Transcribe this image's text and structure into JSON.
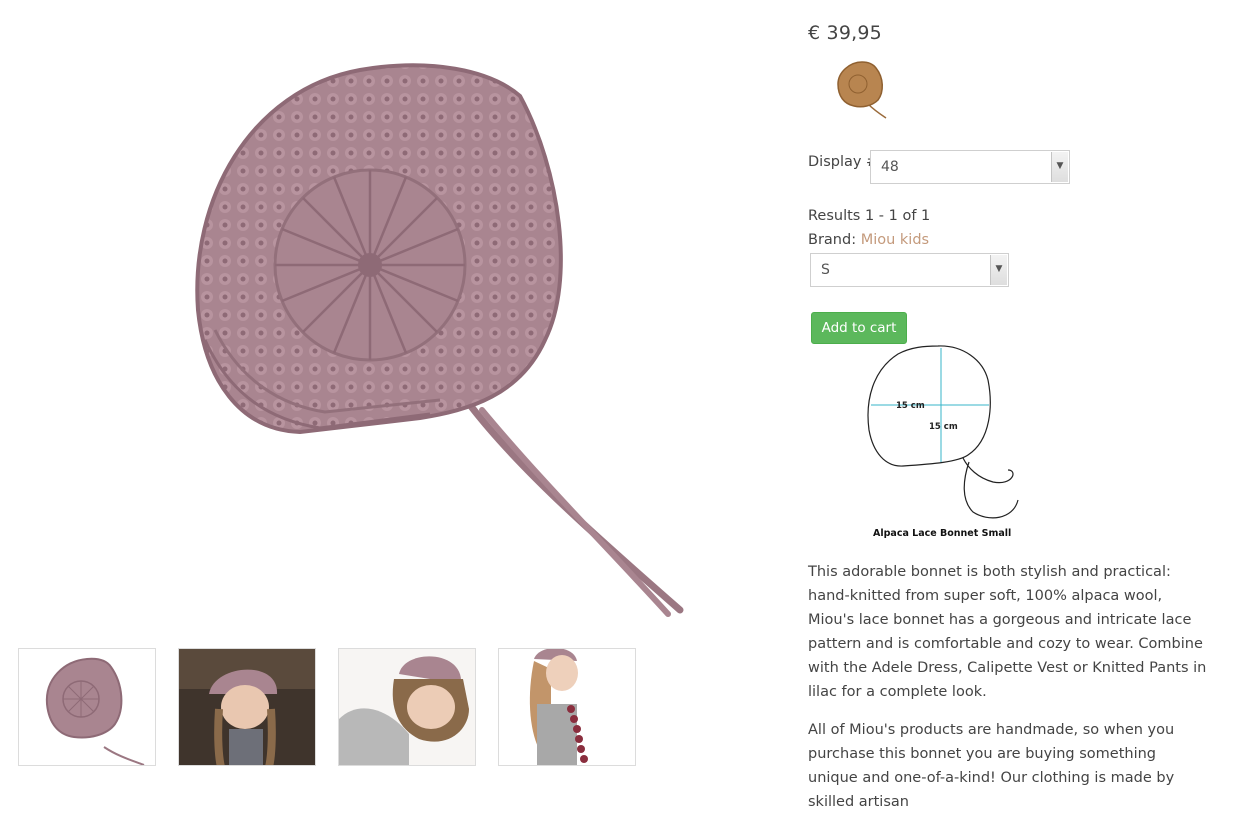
{
  "product": {
    "price": "€ 39,95",
    "display": {
      "label": "Display #",
      "value": "48"
    },
    "results": "Results 1 - 1 of 1",
    "brand": {
      "label": "Brand:",
      "name": "Miou kids"
    },
    "size_select": {
      "value": "S"
    },
    "add_to_cart_label": "Add to cart",
    "diagram": {
      "width_label": "15 cm",
      "height_label": "15 cm",
      "caption": "Alpaca Lace Bonnet Small"
    },
    "description": [
      "This adorable bonnet is both stylish and practical: hand-knitted from super soft, 100% alpaca wool, Miou's lace bonnet has a gorgeous and intricate lace pattern and is comfortable and cozy to wear. Combine with the Adele Dress, Calipette Vest or Knitted Pants in lilac for a complete look.",
      "All of Miou's products are handmade, so when you purchase this bonnet you are buying something unique and one-of-a-kind! Our clothing is made by skilled artisan"
    ]
  },
  "colors": {
    "bonnet": "#a98590",
    "bonnet_dark": "#8e6a76",
    "swatch": "#b88550",
    "brand_link": "#c49a7c",
    "button": "#5cb85c",
    "measure_line": "#37b6c8"
  },
  "thumbnails": [
    {
      "icon": "bonnet-flat-photo"
    },
    {
      "icon": "girl-looking-down-photo"
    },
    {
      "icon": "girl-lying-photo"
    },
    {
      "icon": "girl-side-photo"
    }
  ]
}
